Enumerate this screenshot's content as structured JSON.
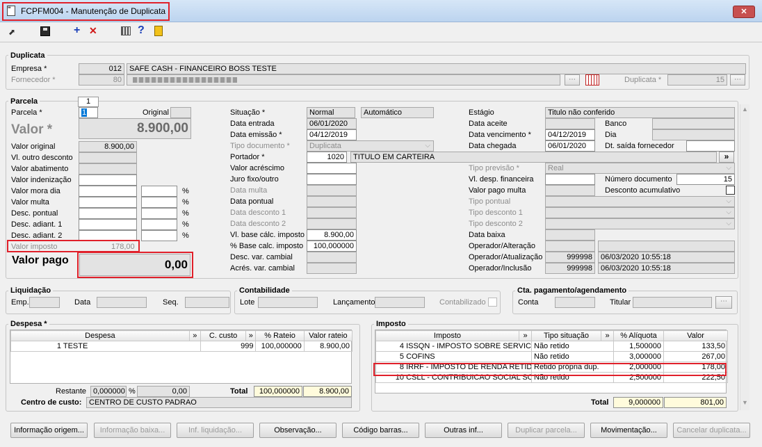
{
  "window": {
    "title": "FCPFM004 - Manutenção de Duplicata",
    "close": "✕"
  },
  "duplicata": {
    "title": "Duplicata",
    "empresa_label": "Empresa *",
    "empresa_code": "012",
    "empresa_name": "SAFE CASH - FINANCEIRO BOSS TESTE",
    "fornecedor_label": "Fornecedor *",
    "fornecedor_code": "80",
    "duplicata_label": "Duplicata *",
    "duplicata_value": "15",
    "lookup": "⋯"
  },
  "parcela": {
    "title": "Parcela",
    "tab": "1",
    "parcela_label": "Parcela *",
    "parcela_value": "1",
    "original_label": "Original",
    "valor_label": "Valor *",
    "valor_value": "8.900,00",
    "left_labels": [
      "Valor original",
      "Vl. outro desconto",
      "Valor abatimento",
      "Valor indenização",
      "Valor mora dia",
      "Valor multa",
      "Desc. pontual",
      "Desc. adiant. 1",
      "Desc. adiant. 2"
    ],
    "valor_original": "8.900,00",
    "pct": "%",
    "valor_imposto_label": "Valor imposto",
    "valor_imposto": "178,00",
    "valor_pago_label": "Valor pago",
    "valor_pago": "0,00"
  },
  "mid": {
    "situacao_label": "Situação *",
    "situacao": "Normal",
    "situacao2": "Automático",
    "data_entrada_label": "Data entrada",
    "data_entrada": "06/01/2020",
    "data_emissao_label": "Data emissão *",
    "data_emissao": "04/12/2019",
    "tipo_doc_label": "Tipo documento *",
    "tipo_doc": "Duplicata",
    "portador_label": "Portador *",
    "portador_code": "1020",
    "portador_name": "TITULO EM CARTEIRA",
    "valor_acrescimo_label": "Valor acréscimo",
    "juro_label": "Juro fixo/outro",
    "data_multa_label": "Data multa",
    "data_pontual_label": "Data pontual",
    "data_desc1_label": "Data desconto 1",
    "data_desc2_label": "Data desconto 2",
    "vl_base_label": "Vl. base cálc. imposto",
    "vl_base": "8.900,00",
    "pct_base_label": "% Base calc. imposto",
    "pct_base": "100,000000",
    "desc_var_label": "Desc. var. cambial",
    "acres_var_label": "Acrés. var. cambial",
    "arrow": "»"
  },
  "right": {
    "estagio_label": "Estágio",
    "estagio": "Titulo não conferido",
    "data_aceite_label": "Data aceite",
    "banco_label": "Banco",
    "data_venc_label": "Data vencimento *",
    "data_venc": "04/12/2019",
    "dia_label": "Dia",
    "data_chegada_label": "Data chegada",
    "data_chegada": "06/01/2020",
    "dt_saida_label": "Dt. saída fornecedor",
    "tipo_prev_label": "Tipo previsão *",
    "tipo_prev": "Real",
    "vl_desp_label": "Vl. desp. financeira",
    "num_doc_label": "Número documento",
    "num_doc": "15",
    "valor_pago_multa_label": "Valor pago multa",
    "desc_acum_label": "Desconto acumulativo",
    "tipo_pontual_label": "Tipo pontual",
    "tipo_desc1_label": "Tipo desconto 1",
    "tipo_desc2_label": "Tipo desconto 2",
    "data_baixa_label": "Data baixa",
    "op_alt_label": "Operador/Alteração",
    "op_atu_label": "Operador/Atualização",
    "op_atu_code": "999998",
    "op_atu_date": "06/03/2020 10:55:18",
    "op_inc_label": "Operador/Inclusão",
    "op_inc_code": "999998",
    "op_inc_date": "06/03/2020 10:55:18"
  },
  "liquidacao": {
    "title": "Liquidação",
    "emp": "Emp.",
    "data": "Data",
    "seq": "Seq."
  },
  "contabilidade": {
    "title": "Contabilidade",
    "lote": "Lote",
    "lancamento": "Lançamento",
    "contabilizado": "Contabilizado"
  },
  "cta": {
    "title": "Cta. pagamento/agendamento",
    "conta": "Conta",
    "titular": "Titular"
  },
  "despesa": {
    "title": "Despesa *",
    "headers": [
      "Despesa",
      "»",
      "C. custo",
      "»",
      "% Rateio",
      "Valor rateio"
    ],
    "rows": [
      {
        "num": "1",
        "name": "TESTE",
        "ccusto": "999",
        "rateio": "100,000000",
        "valor": "8.900,00"
      }
    ],
    "restante_label": "Restante",
    "restante_pct": "0,000000",
    "restante_val": "0,00",
    "total_label": "Total",
    "total_pct": "100,000000",
    "total_val": "8.900,00",
    "centro_label": "Centro de custo:",
    "centro": "CENTRO DE CUSTO PADRAO"
  },
  "imposto": {
    "title": "Imposto",
    "headers": [
      "Imposto",
      "»",
      "Tipo situação",
      "»",
      "% Alíquota",
      "Valor"
    ],
    "rows": [
      {
        "num": "4",
        "name": "ISSQN - IMPOSTO SOBRE SERVICO D",
        "sit": "Não retido",
        "aliq": "1,500000",
        "valor": "133,50"
      },
      {
        "num": "5",
        "name": "COFINS",
        "sit": "Não retido",
        "aliq": "3,000000",
        "valor": "267,00"
      },
      {
        "num": "8",
        "name": "IRRF - IMPOSTO DE RENDA RETIDO N",
        "sit": "Retido própria dup.",
        "aliq": "2,000000",
        "valor": "178,00"
      },
      {
        "num": "10",
        "name": "CSLL - CONTRIBUICAO SOCIAL SOB",
        "sit": "Não retido",
        "aliq": "2,500000",
        "valor": "222,50"
      }
    ],
    "total_label": "Total",
    "total_aliq": "9,000000",
    "total_val": "801,00"
  },
  "buttons": [
    "Informação origem...",
    "Informação baixa...",
    "Inf. liquidação...",
    "Observação...",
    "Código barras...",
    "Outras inf...",
    "Duplicar parcela...",
    "Movimentação...",
    "Cancelar duplicata..."
  ],
  "colors": {
    "highlight": "#e0202a",
    "selection": "#0078d7",
    "total_bg": "#fffbdc"
  }
}
